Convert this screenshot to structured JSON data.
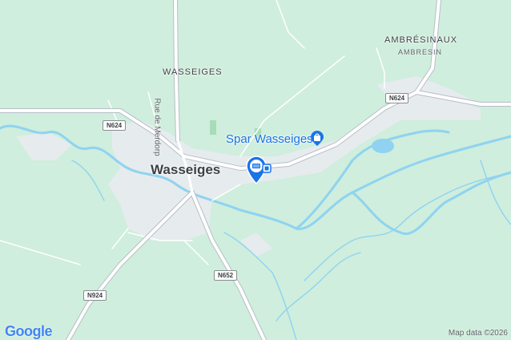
{
  "map": {
    "places": {
      "town": "Wasseiges",
      "village_north": "WASSEIGES",
      "village_ne": "AMBRÉSINAUX",
      "village_ne_sub": "AMBRESIN"
    },
    "streets": {
      "rue_de_merdorp": "Rue de Merdorp"
    },
    "road_shields": {
      "n624_west": "N624",
      "n624_east": "N624",
      "n652": "N652",
      "n924": "N924"
    },
    "poi": {
      "name": "Spar Wasseiges",
      "icon": "shopping-bag-icon",
      "color": "#1a73e8"
    },
    "marker": {
      "icon": "atm-pin-icon",
      "color": "#1a73e8"
    },
    "attribution": {
      "logo": "Google",
      "credit": "Map data ©2026"
    },
    "colors": {
      "land": "#cfeedd",
      "urban": "#e6ebee",
      "water": "#8fd3f0",
      "road": "#ffffff",
      "main_road": "#b8bec7"
    }
  }
}
